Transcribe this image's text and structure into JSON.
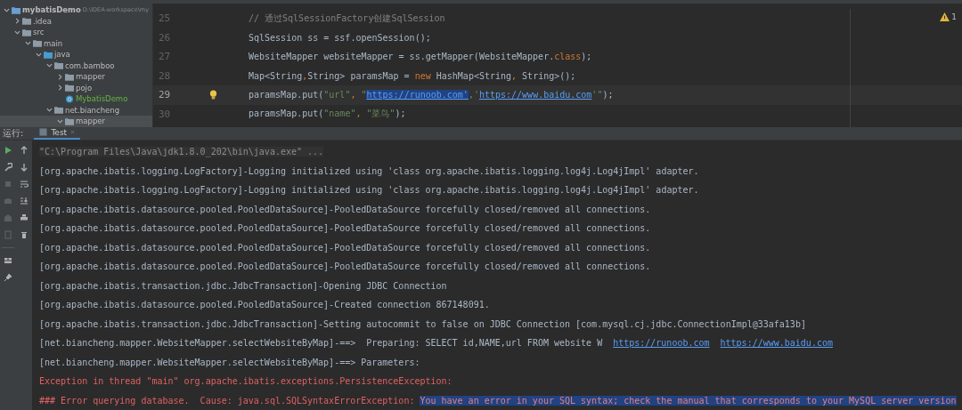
{
  "project_tree": {
    "items": [
      {
        "label": "mybatisDemo",
        "path": "D:\\IDEA-workspace\\my",
        "kind": "project",
        "expanded": true,
        "selected": false,
        "children": [
          {
            "label": ".idea",
            "kind": "folder",
            "expanded": false,
            "selected": false
          },
          {
            "label": "src",
            "kind": "folder",
            "expanded": true,
            "selected": false,
            "children": [
              {
                "label": "main",
                "kind": "folder",
                "expanded": true,
                "selected": false,
                "children": [
                  {
                    "label": "java",
                    "kind": "source",
                    "expanded": true,
                    "selected": false,
                    "children": [
                      {
                        "label": "com.bamboo",
                        "kind": "package",
                        "expanded": true,
                        "selected": false,
                        "children": [
                          {
                            "label": "mapper",
                            "kind": "package",
                            "expanded": false,
                            "selected": false
                          },
                          {
                            "label": "pojo",
                            "kind": "package",
                            "expanded": false,
                            "selected": false
                          },
                          {
                            "label": "MybatisDemo",
                            "kind": "class",
                            "selected": false
                          }
                        ]
                      },
                      {
                        "label": "net.biancheng",
                        "kind": "package",
                        "expanded": true,
                        "selected": false,
                        "children": [
                          {
                            "label": "mapper",
                            "kind": "package",
                            "expanded": true,
                            "selected": true
                          }
                        ]
                      }
                    ]
                  }
                ]
              }
            ]
          }
        ]
      }
    ]
  },
  "editor": {
    "warning_count": "1",
    "lines": [
      {
        "number": "25",
        "current": false,
        "bulb": false,
        "tokens": [
          {
            "text": "// 通过SqlSessionFactory创建SqlSession",
            "kind": "comment"
          }
        ]
      },
      {
        "number": "26",
        "current": false,
        "bulb": false,
        "tokens": [
          {
            "text": "SqlSession ss = ssf.openSession();",
            "kind": "plain"
          }
        ]
      },
      {
        "number": "27",
        "current": false,
        "bulb": false,
        "tokens": [
          {
            "text": "WebsiteMapper websiteMapper = ss.getMapper(WebsiteMapper.",
            "kind": "plain"
          },
          {
            "text": "class",
            "kind": "keyword"
          },
          {
            "text": ");",
            "kind": "plain"
          }
        ]
      },
      {
        "number": "28",
        "current": false,
        "bulb": false,
        "tokens": [
          {
            "text": "Map<String",
            "kind": "plain"
          },
          {
            "text": ",",
            "kind": "keyword"
          },
          {
            "text": "String> paramsMap = ",
            "kind": "plain"
          },
          {
            "text": "new",
            "kind": "keyword"
          },
          {
            "text": " HashMap<String",
            "kind": "plain"
          },
          {
            "text": ",",
            "kind": "keyword"
          },
          {
            "text": " String>();",
            "kind": "plain"
          }
        ]
      },
      {
        "number": "29",
        "current": true,
        "bulb": true,
        "tokens": [
          {
            "text": "paramsMap.put(",
            "kind": "plain"
          },
          {
            "text": "\"url\"",
            "kind": "string"
          },
          {
            "text": ", ",
            "kind": "keyword"
          },
          {
            "text": "\"",
            "kind": "string"
          },
          {
            "text": "https://runoob.com'",
            "kind": "selected-link"
          },
          {
            "text": ",'",
            "kind": "string"
          },
          {
            "text": "https://www.baidu.com",
            "kind": "link"
          },
          {
            "text": "'\"",
            "kind": "string"
          },
          {
            "text": ");",
            "kind": "plain"
          }
        ]
      },
      {
        "number": "30",
        "current": false,
        "bulb": false,
        "tokens": [
          {
            "text": "paramsMap.put(",
            "kind": "plain"
          },
          {
            "text": "\"name\"",
            "kind": "string"
          },
          {
            "text": ", ",
            "kind": "keyword"
          },
          {
            "text": "\"菜鸟\"",
            "kind": "string"
          },
          {
            "text": ");",
            "kind": "plain"
          }
        ]
      }
    ]
  },
  "run_panel": {
    "label": "运行:",
    "tabs": [
      {
        "label": "Test",
        "selected": true
      }
    ]
  },
  "console": {
    "lines": [
      {
        "tokens": [
          {
            "text": "\"C:\\Program Files\\Java\\jdk1.8.0_202\\bin\\java.exe\" ...",
            "kind": "command"
          }
        ]
      },
      {
        "tokens": [
          {
            "text": "[org.apache.ibatis.logging.LogFactory]-Logging initialized using 'class org.apache.ibatis.logging.log4j.Log4jImpl' adapter.",
            "kind": "plain"
          }
        ]
      },
      {
        "tokens": [
          {
            "text": "[org.apache.ibatis.logging.LogFactory]-Logging initialized using 'class org.apache.ibatis.logging.log4j.Log4jImpl' adapter.",
            "kind": "plain"
          }
        ]
      },
      {
        "tokens": [
          {
            "text": "[org.apache.ibatis.datasource.pooled.PooledDataSource]-PooledDataSource forcefully closed/removed all connections.",
            "kind": "plain"
          }
        ]
      },
      {
        "tokens": [
          {
            "text": "[org.apache.ibatis.datasource.pooled.PooledDataSource]-PooledDataSource forcefully closed/removed all connections.",
            "kind": "plain"
          }
        ]
      },
      {
        "tokens": [
          {
            "text": "[org.apache.ibatis.datasource.pooled.PooledDataSource]-PooledDataSource forcefully closed/removed all connections.",
            "kind": "plain"
          }
        ]
      },
      {
        "tokens": [
          {
            "text": "[org.apache.ibatis.datasource.pooled.PooledDataSource]-PooledDataSource forcefully closed/removed all connections.",
            "kind": "plain"
          }
        ]
      },
      {
        "tokens": [
          {
            "text": "[org.apache.ibatis.transaction.jdbc.JdbcTransaction]-Opening JDBC Connection",
            "kind": "plain"
          }
        ]
      },
      {
        "tokens": [
          {
            "text": "[org.apache.ibatis.datasource.pooled.PooledDataSource]-Created connection 867148091.",
            "kind": "plain"
          }
        ]
      },
      {
        "tokens": [
          {
            "text": "[org.apache.ibatis.transaction.jdbc.JdbcTransaction]-Setting autocommit to false on JDBC Connection [com.mysql.cj.jdbc.ConnectionImpl@33afa13b]",
            "kind": "plain"
          }
        ]
      },
      {
        "tokens": [
          {
            "text": "[net.biancheng.mapper.WebsiteMapper.selectWebsiteByMap]-==>  Preparing: SELECT id,NAME,url FROM website W",
            "kind": "plain"
          },
          {
            "text": "https://runoob.com",
            "kind": "link"
          },
          {
            "text": "https://www.baidu.com",
            "kind": "link"
          }
        ]
      },
      {
        "tokens": [
          {
            "text": "[net.biancheng.mapper.WebsiteMapper.selectWebsiteByMap]-==> Parameters:",
            "kind": "plain"
          }
        ]
      },
      {
        "tokens": [
          {
            "text": "Exception in thread \"main\" org.apache.ibatis.exceptions.PersistenceException:",
            "kind": "error"
          }
        ]
      },
      {
        "tokens": [
          {
            "text": "### Error querying database.  Cause: java.sql.SQLSyntaxErrorException:",
            "kind": "error"
          },
          {
            "text": "You have an error in your SQL syntax; check the manual that corresponds to your MySQL server version",
            "kind": "error-selected"
          }
        ]
      }
    ]
  }
}
